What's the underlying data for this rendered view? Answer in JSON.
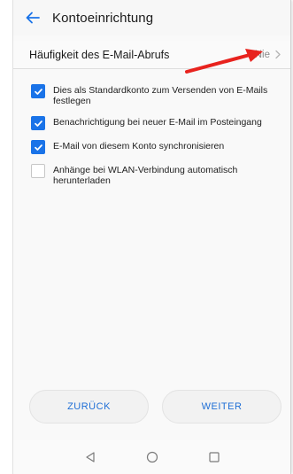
{
  "app_bar": {
    "title": "Kontoeinrichtung",
    "back_icon": "back-arrow-icon"
  },
  "sync_frequency": {
    "label": "Häufigkeit des E-Mail-Abrufs",
    "value": "Nie",
    "chevron_icon": "chevron-right-icon"
  },
  "options": [
    {
      "label": "Dies als Standardkonto zum Versenden von E-Mails festlegen",
      "checked": true
    },
    {
      "label": "Benachrichtigung bei neuer E-Mail im Posteingang",
      "checked": true
    },
    {
      "label": "E-Mail von diesem Konto synchronisieren",
      "checked": true
    },
    {
      "label": "Anhänge bei WLAN-Verbindung automatisch herunterladen",
      "checked": false
    }
  ],
  "buttons": {
    "back_label": "ZURÜCK",
    "next_label": "WEITER"
  },
  "nav_bar": {
    "back_icon": "triangle-back-icon",
    "home_icon": "circle-home-icon",
    "recents_icon": "square-recents-icon"
  },
  "colors": {
    "accent": "#1a73e8",
    "button_text": "#1f6fd6",
    "annotation_arrow": "#e8231e"
  }
}
